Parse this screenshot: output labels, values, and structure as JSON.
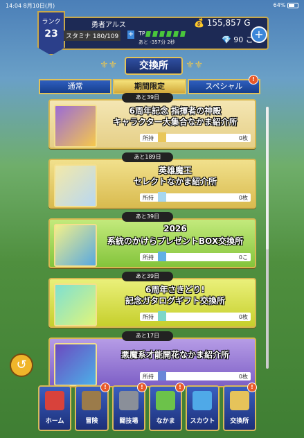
{
  "status": {
    "time": "14:04",
    "date": "8月10日(月)",
    "battery": "64%"
  },
  "header": {
    "rank_label": "ランク",
    "rank_value": "23",
    "player_name": "勇者アルス",
    "gold": "155,857 G",
    "stamina_label": "スタミナ",
    "stamina_value": "180/109",
    "tp_label": "TP",
    "tp_note": "あと -357分 2秒",
    "gems": "90 こ"
  },
  "page_title": "交換所",
  "tabs": [
    {
      "label": "通常"
    },
    {
      "label": "期間限定"
    },
    {
      "label": "スペシャル"
    }
  ],
  "cards": [
    {
      "tag": "あと39日",
      "line1": "6周年記念 指揮者の神殿",
      "line2": "キャラクター大集合なかま紹介所",
      "owned_label": "所持",
      "owned_value": "0枚",
      "bg": "#e9d89a"
    },
    {
      "tag": "あと189日",
      "line1": "英雄魔王",
      "line2": "セレクトなかま紹介所",
      "owned_label": "所持",
      "owned_value": "0枚",
      "bg": "#e6d274"
    },
    {
      "tag": "あと39日",
      "line1": "2026",
      "line2": "系統のかけらプレゼントBOX交換所",
      "owned_label": "所持",
      "owned_value": "0こ",
      "bg": "#9bd34b"
    },
    {
      "tag": "あと39日",
      "line1": "6周年さきどり!",
      "line2": "記念ガタログギフト交換所",
      "owned_label": "所持",
      "owned_value": "0枚",
      "bg": "#d5de3f"
    },
    {
      "tag": "あと17日",
      "line1": "悪魔系才能開花なかま紹介所",
      "line2": "",
      "owned_label": "所持",
      "owned_value": "0枚",
      "bg": "#9f7fd8"
    }
  ],
  "bottom_nav": [
    {
      "label": "ホーム"
    },
    {
      "label": "冒険"
    },
    {
      "label": "闘技場"
    },
    {
      "label": "なかま"
    },
    {
      "label": "スカウト"
    },
    {
      "label": "交換所"
    }
  ]
}
